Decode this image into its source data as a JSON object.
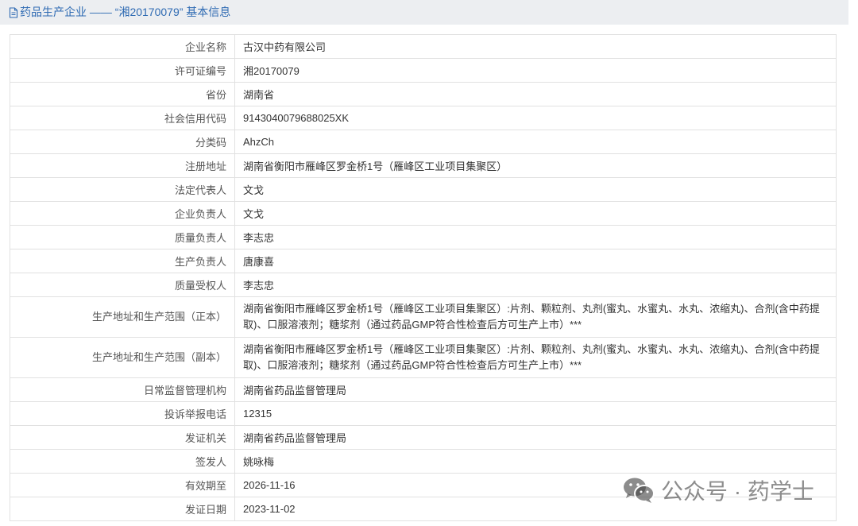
{
  "header": {
    "icon": "document-icon",
    "title": "药品生产企业 —— “湘20170079” 基本信息",
    "color": "#2f6bb3"
  },
  "rows": [
    {
      "label": "企业名称",
      "value": "古汉中药有限公司"
    },
    {
      "label": "许可证编号",
      "value": "湘20170079"
    },
    {
      "label": "省份",
      "value": "湖南省"
    },
    {
      "label": "社会信用代码",
      "value": "9143040079688025XK"
    },
    {
      "label": "分类码",
      "value": "AhzCh"
    },
    {
      "label": "注册地址",
      "value": "湖南省衡阳市雁峰区罗金桥1号（雁峰区工业项目集聚区）"
    },
    {
      "label": "法定代表人",
      "value": "文戈"
    },
    {
      "label": "企业负责人",
      "value": "文戈"
    },
    {
      "label": "质量负责人",
      "value": "李志忠"
    },
    {
      "label": "生产负责人",
      "value": "唐康喜"
    },
    {
      "label": "质量受权人",
      "value": "李志忠"
    },
    {
      "label": "生产地址和生产范围（正本）",
      "value": "湖南省衡阳市雁峰区罗金桥1号（雁峰区工业项目集聚区）:片剂、颗粒剂、丸剂(蜜丸、水蜜丸、水丸、浓缩丸)、合剂(含中药提取)、口服溶液剂；糖浆剂（通过药品GMP符合性检查后方可生产上市）***"
    },
    {
      "label": "生产地址和生产范围（副本）",
      "value": "湖南省衡阳市雁峰区罗金桥1号（雁峰区工业项目集聚区）:片剂、颗粒剂、丸剂(蜜丸、水蜜丸、水丸、浓缩丸)、合剂(含中药提取)、口服溶液剂；糖浆剂（通过药品GMP符合性检查后方可生产上市）***"
    },
    {
      "label": "日常监督管理机构",
      "value": "湖南省药品监督管理局"
    },
    {
      "label": "投诉举报电话",
      "value": "12315"
    },
    {
      "label": "发证机关",
      "value": "湖南省药品监督管理局"
    },
    {
      "label": "签发人",
      "value": "姚咏梅"
    },
    {
      "label": "有效期至",
      "value": "2026-11-16"
    },
    {
      "label": "发证日期",
      "value": "2023-11-02"
    }
  ],
  "watermark": {
    "icon": "wechat-icon",
    "text": "公众号 · 药学士"
  }
}
